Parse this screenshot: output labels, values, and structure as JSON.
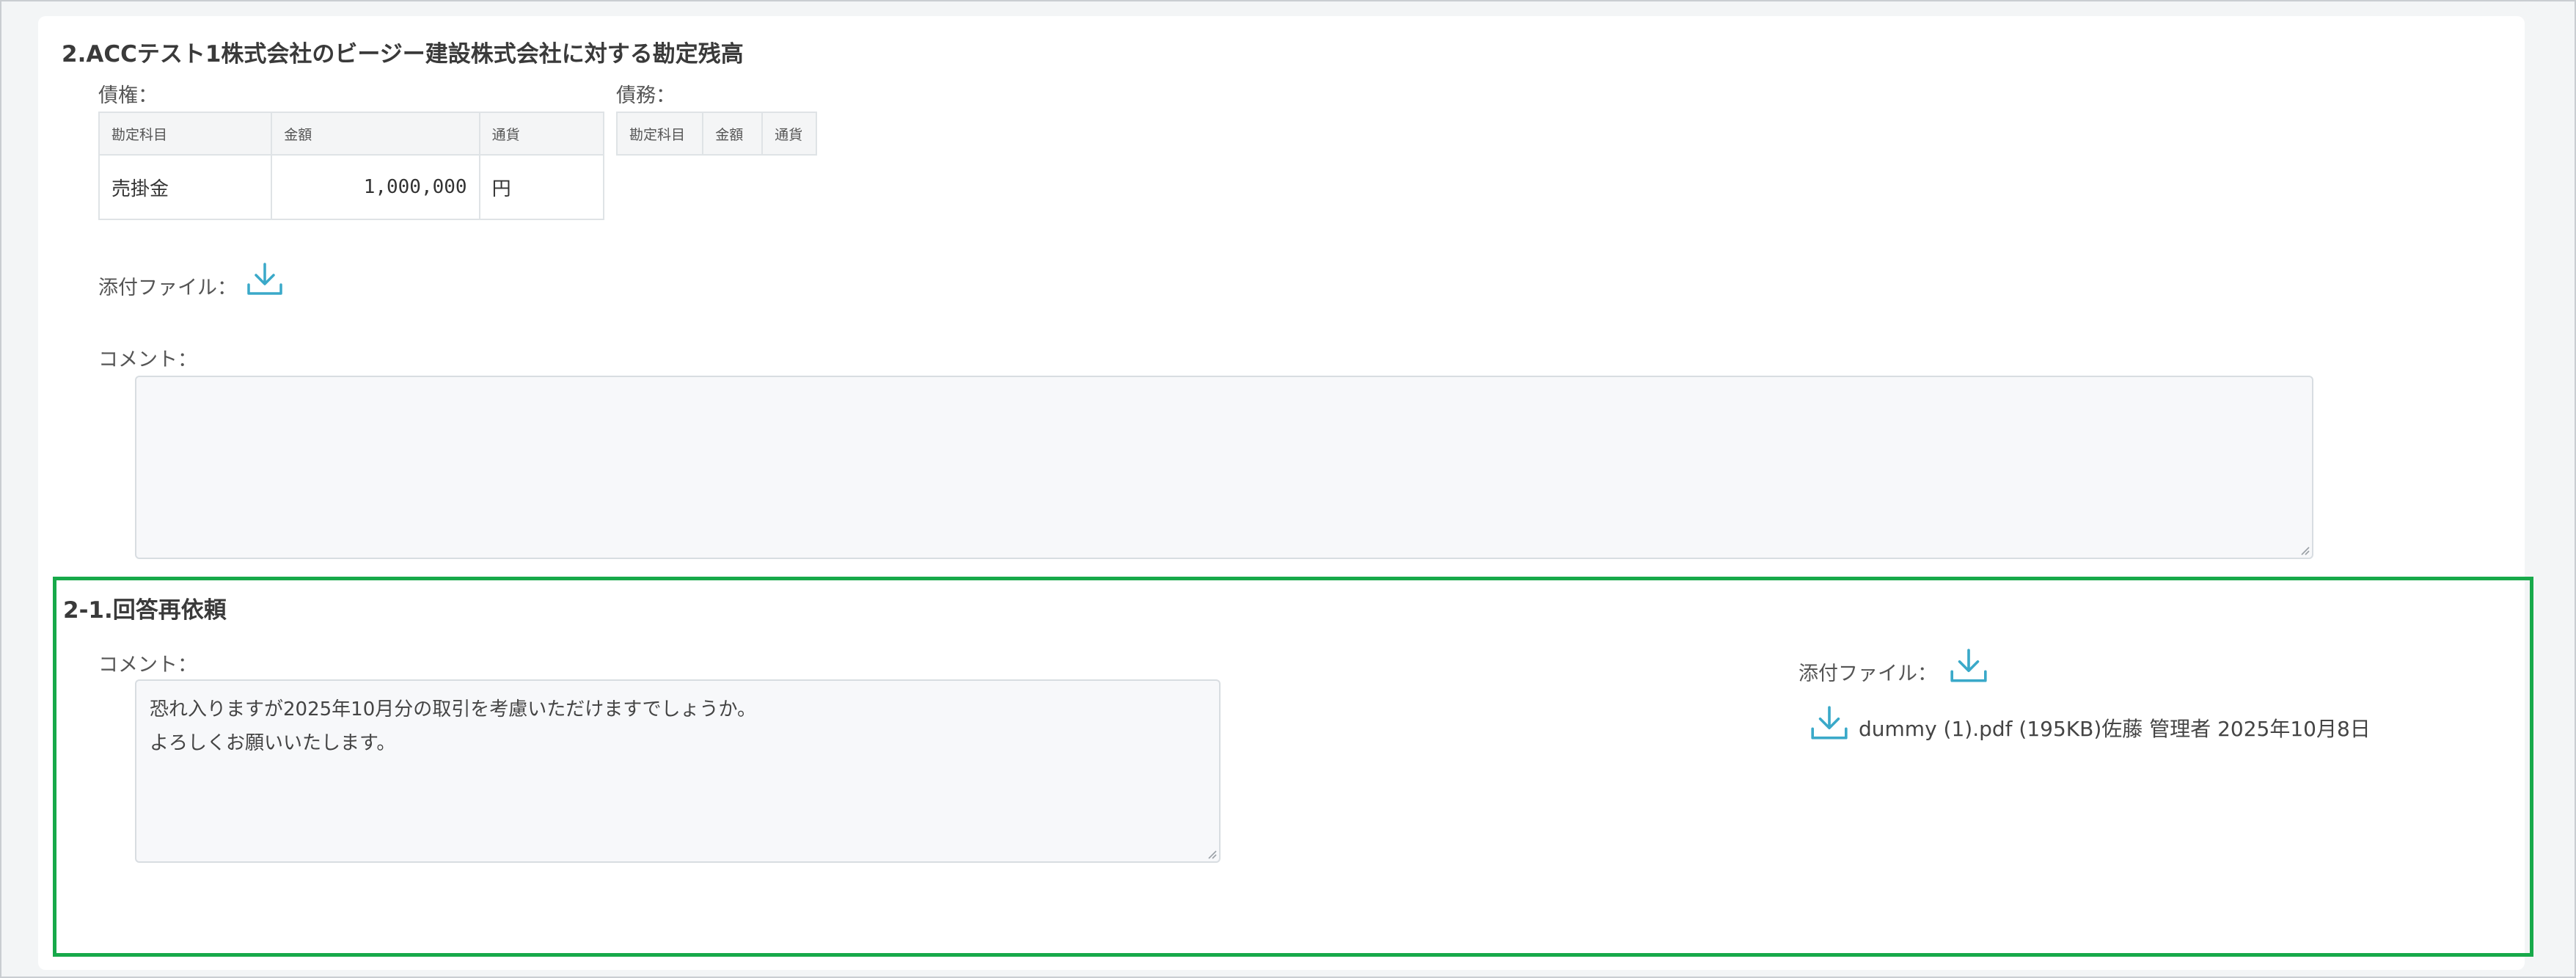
{
  "section1": {
    "title": "2.ACCテスト1株式会社のビージー建設株式会社に対する勘定残高",
    "receivables": {
      "label": "債権：",
      "headers": [
        "勘定科目",
        "金額",
        "通貨"
      ],
      "rows": [
        {
          "account": "売掛金",
          "amount": "1,000,000",
          "currency": "円"
        }
      ]
    },
    "payables": {
      "label": "債務：",
      "headers": [
        "勘定科目",
        "金額",
        "通貨"
      ]
    },
    "attachment_label": "添付ファイル：",
    "comment_label": "コメント：",
    "comment_value": ""
  },
  "section2": {
    "title": "2-1.回答再依頼",
    "comment_label": "コメント：",
    "comment_value": "恐れ入りますが2025年10月分の取引を考慮いただけますでしょうか。\nよろしくお願いいたします。",
    "attachment_label": "添付ファイル：",
    "file": {
      "text": "dummy (1).pdf (195KB)佐藤 管理者 2025年10月8日"
    }
  },
  "colors": {
    "accent": "#3aa9c9",
    "highlight_border": "#17a94a"
  },
  "icons": {
    "download": "download-icon"
  }
}
